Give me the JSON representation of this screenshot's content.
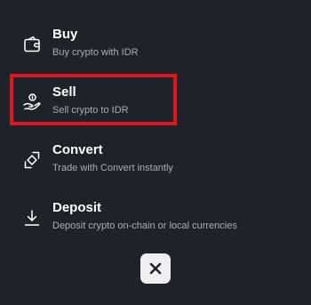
{
  "menu": {
    "items": [
      {
        "icon": "wallet-icon",
        "title": "Buy",
        "subtitle": "Buy crypto with IDR"
      },
      {
        "icon": "hand-coin-icon",
        "title": "Sell",
        "subtitle": "Sell crypto to IDR"
      },
      {
        "icon": "convert-icon",
        "title": "Convert",
        "subtitle": "Trade with Convert instantly"
      },
      {
        "icon": "download-icon",
        "title": "Deposit",
        "subtitle": "Deposit crypto on-chain or local currencies"
      }
    ],
    "highlighted_item": "Sell"
  },
  "close_button": {
    "icon": "close-icon"
  },
  "colors": {
    "background": "#1e2229",
    "title": "#ffffff",
    "subtitle": "#a8adb7",
    "highlight": "#e0161e",
    "close_button_bg": "#eeeff1",
    "close_icon": "#1e2229"
  }
}
